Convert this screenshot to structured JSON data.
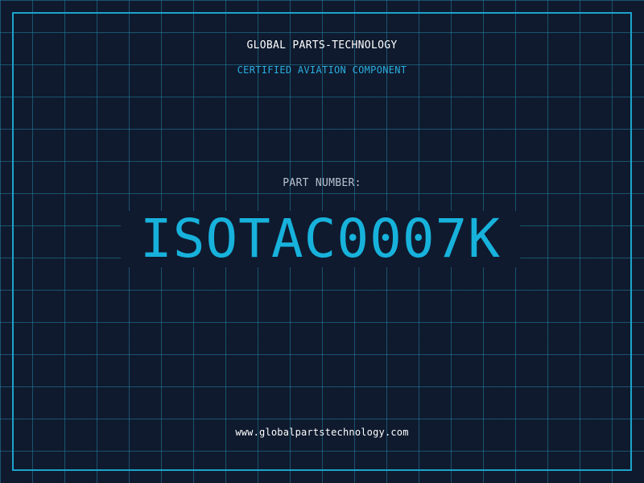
{
  "header": {
    "company": "GLOBAL PARTS-TECHNOLOGY",
    "subtitle": "CERTIFIED AVIATION COMPONENT"
  },
  "part": {
    "label": "PART NUMBER:",
    "number": "ISOTAC0007K"
  },
  "footer": {
    "website": "www.globalpartstechnology.com"
  },
  "colors": {
    "background": "#0f1a2e",
    "grid": "#2282a0",
    "accent": "#1ca3cc",
    "part_number": "#17b2dc",
    "text": "#ffffff"
  }
}
